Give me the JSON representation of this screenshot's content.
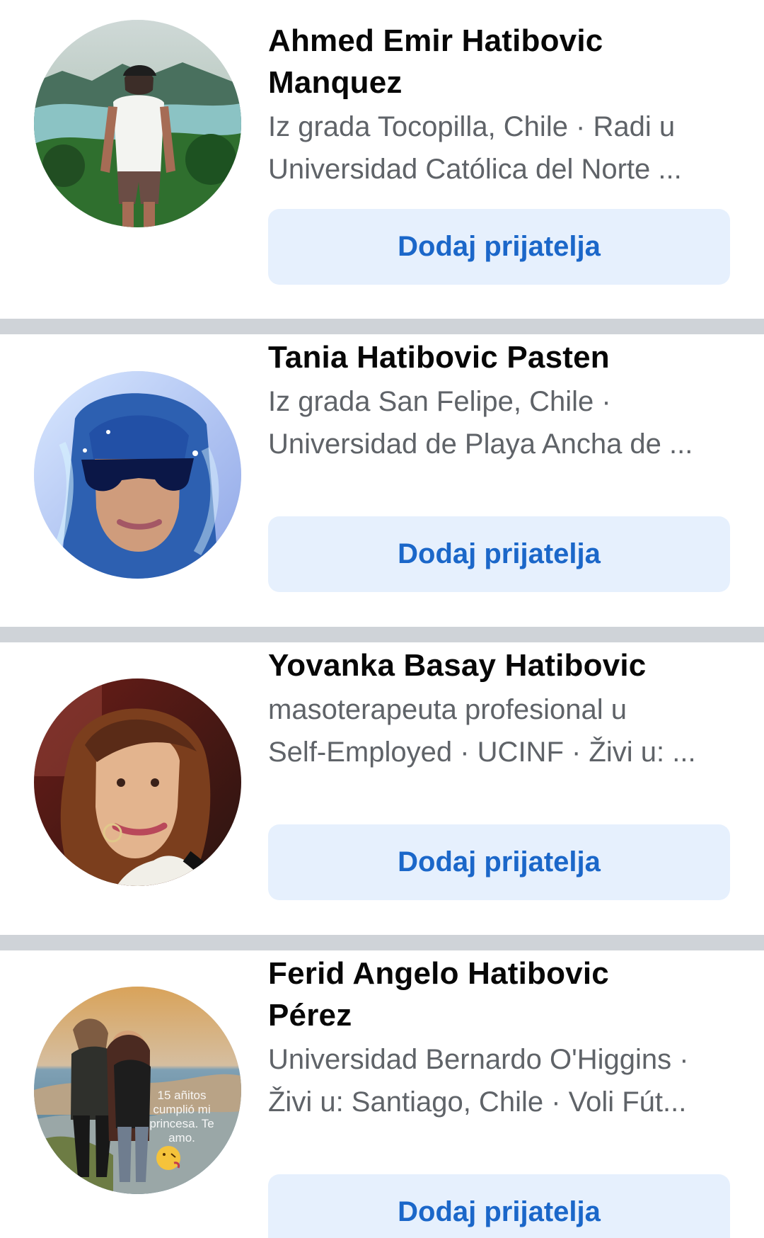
{
  "header": {
    "active_tab_indicator": "#1b67c9"
  },
  "theme": {
    "button_bg": "#e6f0fd",
    "button_text": "#1b67c9",
    "divider": "#cfd3d8"
  },
  "results": [
    {
      "name_line_1": "Ahmed Emir Hatibovic",
      "name_line_2": "Manquez",
      "meta_line_1": "Iz grada Tocopilla, Chile · Radi u",
      "meta_line_2": "Universidad Católica del Norte ...",
      "button_label": "Dodaj prijatelja",
      "avatar_icon": "profile-photo-icon"
    },
    {
      "name_line_1": "Tania Hatibovic Pasten",
      "meta_line_1": "Iz grada San Felipe, Chile ·",
      "meta_line_2": "Universidad de Playa Ancha de ...",
      "button_label": "Dodaj prijatelja",
      "avatar_icon": "profile-photo-icon"
    },
    {
      "name_line_1": "Yovanka Basay Hatibovic",
      "meta_line_1": "masoterapeuta profesional u",
      "meta_line_2": "Self-Employed · UCINF · Živi u: ...",
      "button_label": "Dodaj prijatelja",
      "avatar_icon": "profile-photo-icon"
    },
    {
      "name_line_1": "Ferid Angelo Hatibovic",
      "name_line_2": "Pérez",
      "meta_line_1": "Universidad Bernardo O'Higgins ·",
      "meta_line_2": "Živi u: Santiago, Chile · Voli Fút...",
      "button_label": "Dodaj prijatelja",
      "avatar_icon": "profile-photo-icon",
      "photo_caption": [
        "15 añitos",
        "cumplió mi",
        "princesa. Te",
        "amo."
      ]
    }
  ]
}
